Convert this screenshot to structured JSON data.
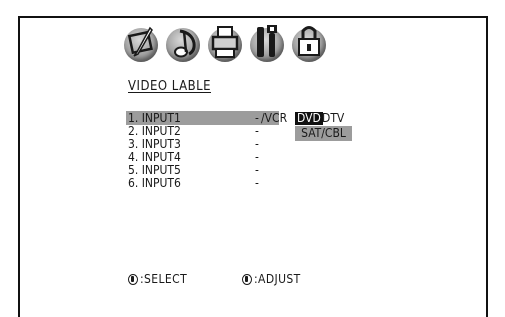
{
  "menu_icons": [
    {
      "name": "picture-brush-icon"
    },
    {
      "name": "music-note-icon"
    },
    {
      "name": "printer-icon"
    },
    {
      "name": "tools-icon"
    },
    {
      "name": "lock-icon"
    }
  ],
  "title": "VIDEO LABLE",
  "inputs": [
    {
      "label": "1. INPUT1",
      "value": "-"
    },
    {
      "label": "2. INPUT2",
      "value": "-"
    },
    {
      "label": "3. INPUT3",
      "value": "-"
    },
    {
      "label": "4. INPUT4",
      "value": "-"
    },
    {
      "label": "5. INPUT5",
      "value": "-"
    },
    {
      "label": "6. INPUT6",
      "value": "-"
    }
  ],
  "selected_row_options": {
    "vcr": "/VCR",
    "dvd": "DVD",
    "dtv": "DTV"
  },
  "dropdown_option": "SAT/CBL",
  "footer": {
    "select": ":SELECT",
    "adjust": ":ADJUST"
  },
  "colors": {
    "highlight": "#9c9c9c",
    "selected_bg": "#111111",
    "selected_fg": "#ffffff",
    "border": "#111111"
  }
}
